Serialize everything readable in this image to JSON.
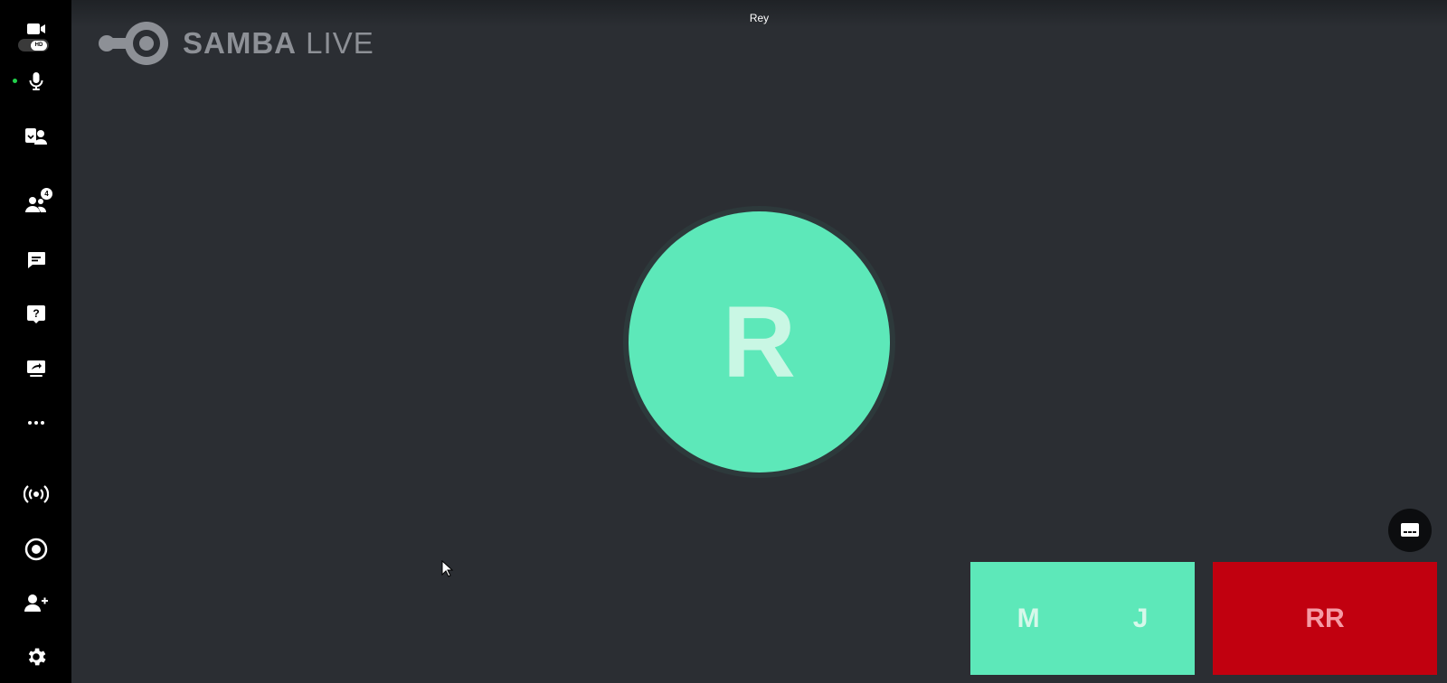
{
  "colors": {
    "background": "#2b2e33",
    "sidebar": "#000000",
    "mint": "#5de8b9",
    "red": "#c1000f",
    "mic_active": "#22d14b"
  },
  "sidebar": {
    "camera": {
      "icon": "video-camera-icon",
      "hd_label": "HD"
    },
    "microphone": {
      "icon": "microphone-icon"
    },
    "participants_view": {
      "icon": "participants-view-icon"
    },
    "participants": {
      "icon": "people-icon",
      "badge": "4"
    },
    "chat": {
      "icon": "chat-icon"
    },
    "questions": {
      "icon": "question-icon"
    },
    "share_screen": {
      "icon": "share-screen-icon"
    },
    "more": {
      "icon": "more-icon"
    },
    "broadcast": {
      "icon": "broadcast-icon"
    },
    "record": {
      "icon": "record-icon"
    },
    "invite": {
      "icon": "add-user-icon"
    },
    "settings": {
      "icon": "settings-icon"
    }
  },
  "top_bar": {
    "speaker_name": "Rey"
  },
  "logo": {
    "brand_bold": "SAMBA",
    "brand_light": " LIVE"
  },
  "main_stage": {
    "avatar_initial": "R"
  },
  "captions_button": {
    "icon": "closed-captions-icon"
  },
  "thumbnails": [
    {
      "initials": [
        "M",
        "J"
      ]
    },
    {
      "initials": [
        "RR"
      ]
    }
  ]
}
